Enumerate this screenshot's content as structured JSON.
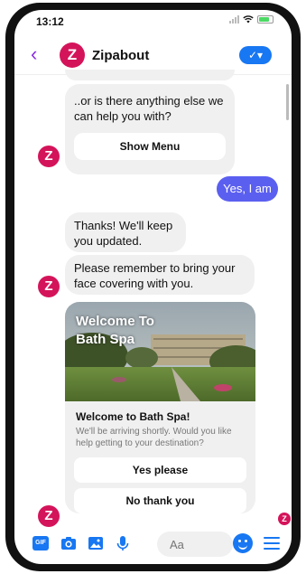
{
  "status": {
    "time": "13:12"
  },
  "header": {
    "title": "Zipabout",
    "avatar_letter": "Z",
    "back_icon": "chevron-left-icon",
    "check_label": "✓▾"
  },
  "chat": {
    "bot_msg_1": "..or is there anything else we can help you with?",
    "show_menu": "Show Menu",
    "user_reply": "Yes, I am",
    "bot_msg_2": "Thanks! We'll keep you updated.",
    "bot_msg_3": "Please remember to bring your face covering with you."
  },
  "card": {
    "image_text": "Welcome To Bath Spa",
    "title": "Welcome to Bath Spa!",
    "subtitle": "We'll be arriving shortly. Would you like help getting to your destination?",
    "btn_yes": "Yes please",
    "btn_no": "No thank you"
  },
  "composer": {
    "gif_label": "GIF",
    "placeholder": "Aa"
  },
  "colors": {
    "brand": "#d4145a",
    "messenger_blue": "#1877f2",
    "user_bubble": "#5b5ff0"
  }
}
